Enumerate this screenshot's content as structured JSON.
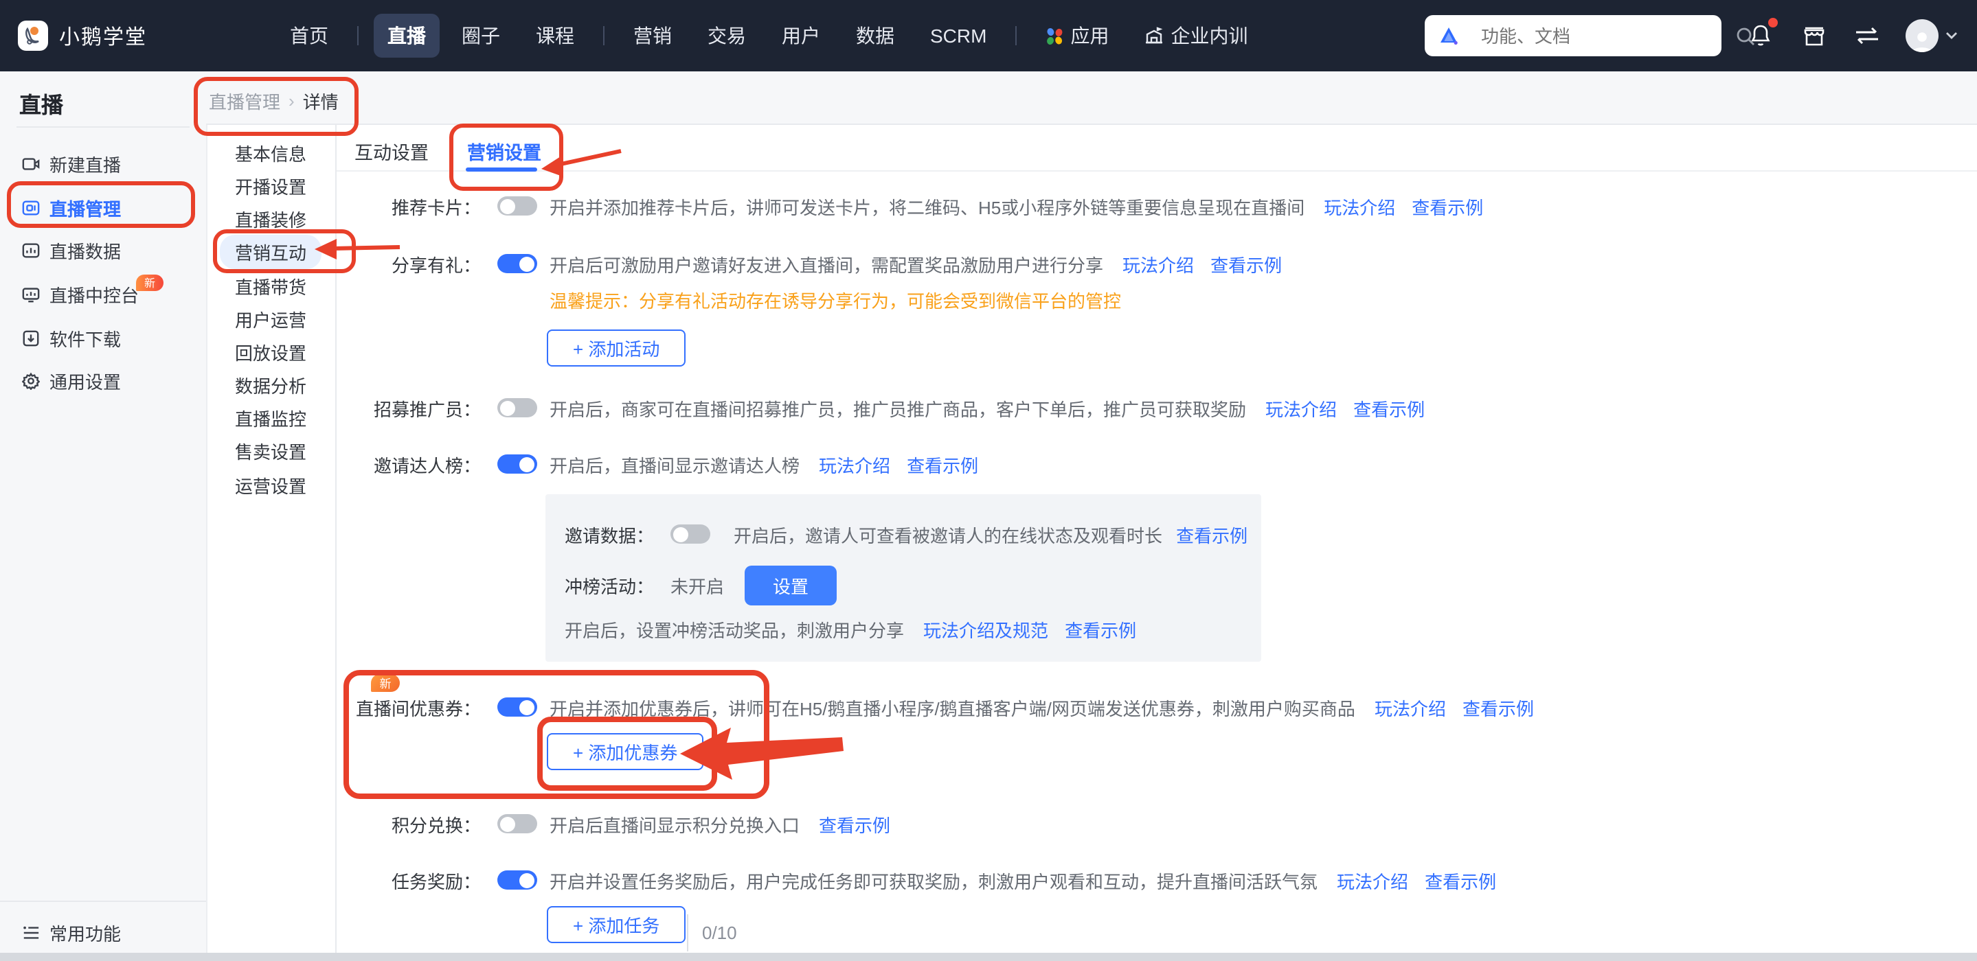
{
  "topnav": {
    "brand": "小鹅学堂",
    "items": [
      "首页",
      "直播",
      "圈子",
      "课程",
      "营销",
      "交易",
      "用户",
      "数据",
      "SCRM",
      "应用",
      "企业内训"
    ],
    "active_item": "直播",
    "search": {
      "placeholder": "功能、文档"
    }
  },
  "sidebar": {
    "title": "直播",
    "items": [
      {
        "label": "新建直播"
      },
      {
        "label": "直播管理",
        "active": true
      },
      {
        "label": "直播数据"
      },
      {
        "label": "直播中控台",
        "badge": "新"
      },
      {
        "label": "软件下载"
      },
      {
        "label": "通用设置"
      }
    ],
    "footer": "常用功能"
  },
  "breadcrumb": {
    "parent": "直播管理",
    "separator": "›",
    "current": "详情"
  },
  "submenu": {
    "items": [
      "基本信息",
      "开播设置",
      "直播装修",
      "营销互动",
      "直播带货",
      "用户运营",
      "回放设置",
      "数据分析",
      "直播监控",
      "售卖设置",
      "运营设置"
    ],
    "active_item": "营销互动"
  },
  "tabs": [
    "互动设置",
    "营销设置"
  ],
  "active_tab": "营销设置",
  "settings": {
    "rows": [
      {
        "label": "推荐卡片：",
        "toggle": "off",
        "desc": "开启并添加推荐卡片后，讲师可发送卡片，将二维码、H5或小程序外链等重要信息呈现在直播间",
        "links": [
          "玩法介绍",
          "查看示例"
        ]
      },
      {
        "label": "分享有礼：",
        "toggle": "on",
        "desc": "开启后可激励用户邀请好友进入直播间，需配置奖品激励用户进行分享",
        "links": [
          "玩法介绍",
          "查看示例"
        ],
        "tip": "温馨提示：分享有礼活动存在诱导分享行为，可能会受到微信平台的管控",
        "button": "+ 添加活动"
      },
      {
        "label": "招募推广员：",
        "toggle": "off",
        "desc": "开启后，商家可在直播间招募推广员，推广员推广商品，客户下单后，推广员可获取奖励",
        "links": [
          "玩法介绍",
          "查看示例"
        ]
      },
      {
        "label": "邀请达人榜：",
        "toggle": "on",
        "desc": "开启后，直播间显示邀请达人榜",
        "links": [
          "玩法介绍",
          "查看示例"
        ]
      },
      {
        "label": "直播间优惠券：",
        "badge": "新",
        "toggle": "on",
        "desc": "开启并添加优惠券后，讲师可在H5/鹅直播小程序/鹅直播客户端/网页端发送优惠券，刺激用户购买商品",
        "links": [
          "玩法介绍",
          "查看示例"
        ],
        "button": "+ 添加优惠券"
      },
      {
        "label": "积分兑换：",
        "toggle": "off",
        "desc": "开启后直播间显示积分兑换入口",
        "links": [
          "查看示例"
        ]
      },
      {
        "label": "任务奖励：",
        "toggle": "on",
        "desc": "开启并设置任务奖励后，用户完成任务即可获取奖励，刺激用户观看和互动，提升直播间活跃气氛",
        "links": [
          "玩法介绍",
          "查看示例"
        ],
        "button": "+ 添加任务",
        "counter": "0/10"
      }
    ],
    "panel": {
      "invite_data": {
        "label": "邀请数据：",
        "toggle": "off",
        "desc": "开启后，邀请人可查看被邀请人的在线状态及观看时长",
        "link": "查看示例"
      },
      "rank": {
        "label": "冲榜活动：",
        "status": "未开启",
        "button": "设置"
      },
      "note": {
        "text": "开启后，设置冲榜活动奖品，刺激用户分享",
        "links": [
          "玩法介绍及规范",
          "查看示例"
        ]
      }
    }
  },
  "colors": {
    "accent": "#3370ff",
    "annotation_red": "#e8402a",
    "warning_orange": "#f9a11b",
    "nav_bg": "#1d2433",
    "badge_gradient": "#ff8f40→#f5483b"
  },
  "icons": [
    "goose-logo-icon",
    "search-logo-icon",
    "magnifier-icon",
    "bell-icon",
    "storefront-icon",
    "swap-icon",
    "avatar",
    "chevron-down-icon",
    "apps-grid-icon",
    "building-icon",
    "camera-icon",
    "live-screen-icon",
    "bar-chart-icon",
    "monitor-icon",
    "download-icon",
    "gear-icon",
    "list-icon"
  ]
}
